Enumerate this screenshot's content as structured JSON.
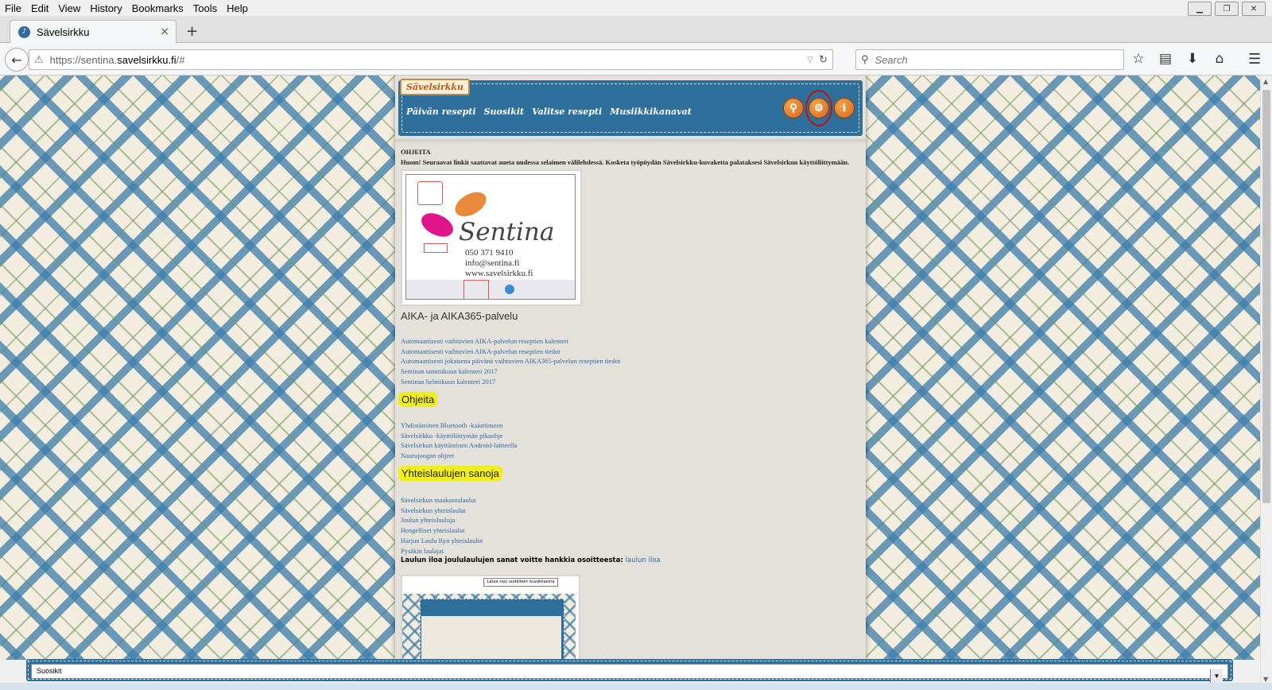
{
  "menu": [
    "File",
    "Edit",
    "View",
    "History",
    "Bookmarks",
    "Tools",
    "Help"
  ],
  "tab": {
    "title": "Sävelsirkku",
    "close": "×",
    "new": "+"
  },
  "nav": {
    "url_prefix": "https://sentina.",
    "url_domain": "savelsirkku.fi",
    "url_suffix": "/#",
    "search_placeholder": "Search"
  },
  "app": {
    "logo": "Sävelsirkku",
    "nav_items": [
      "Päivän resepti",
      "Suosikit",
      "Valitse resepti",
      "Musiikkikanavat"
    ],
    "info_icon": "i",
    "heading_small": "OHJEITA",
    "notice": "Huom! Seuraavat linkit saattavat aueta uudessa selaimen välilehdessä. Kosketa työpöydän Sävelsirkku-kuvaketta palataksesi Sävelsirkun käyttöliittymään.",
    "image1": {
      "brand": "Sentina",
      "phone": "050 371 9410",
      "email": "info@sentina.fi",
      "web": "www.savelsirkku.fi"
    },
    "section_aika": {
      "title": "AIKA- ja AIKA365-palvelu",
      "links": [
        "Automaattisesti vaihtuvien AIKA-palvelun reseptien kalenteri",
        "Automaattisesti vaihtuvien AIKA-palvelun reseptien tiedot",
        "Automaattisesti jokaisena päivänä vaihtuvien AIKA365-palvelun reseptien tiedot",
        "Sentinan tammikuun kalenteri 2017",
        "Sentinan helmikuun kalenteri 2017"
      ]
    },
    "section_ohjeita": {
      "title": "Ohjeita",
      "links": [
        "Yhdistäminen Bluetooth -kaiuttimeen",
        "Sävelsirkku -käyttöliittymän pikaohje",
        "Sävelsirkun käyttäminen Android-laitteella",
        "Naurujoogan ohjeet"
      ]
    },
    "section_sanoja": {
      "title": "Yhteislaulujen sanoja",
      "links": [
        "Sävelsirkun maakuntalaulut",
        "Sävelsirkun yhteislaulut",
        "Joulun yhteislauluja",
        "Hengelliset yhteislaulut",
        "Harjun Laulu Ryn yhteislaulut",
        "Pysäkin laulajat"
      ]
    },
    "last_line_text": "Laulun iloa joululaulujen sanat voitte hankkia osoitteesta: ",
    "last_line_link": "laulun iloa",
    "image2_note": "Lataa sivu uudelleen kuvakkeesta"
  },
  "bottom_select": {
    "value": "Suosikit",
    "arrow": "▼"
  },
  "colors": {
    "header_blue": "#2f6f9b",
    "orange_button": "#e07a2a",
    "highlight": "#f2ee1a",
    "link": "#3168a8",
    "annotation_red": "#c01010"
  }
}
